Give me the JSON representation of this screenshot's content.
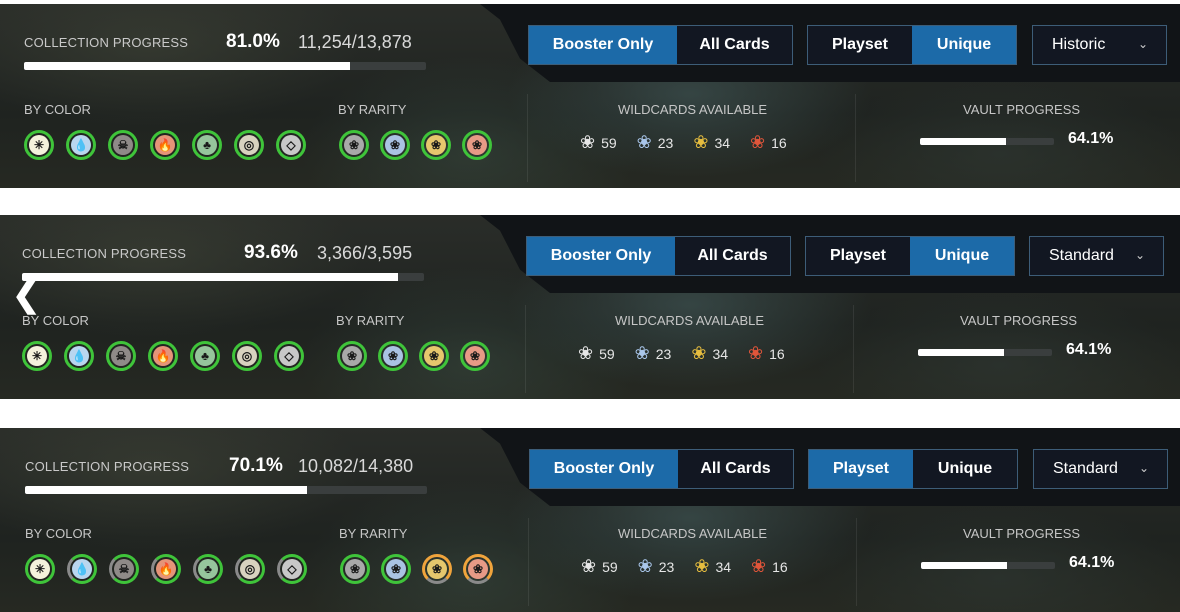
{
  "labels": {
    "collection_progress": "COLLECTION PROGRESS",
    "by_color": "BY COLOR",
    "by_rarity": "BY RARITY",
    "wildcards_available": "WILDCARDS AVAILABLE",
    "vault_progress": "VAULT PROGRESS"
  },
  "buttons": {
    "booster_only": "Booster Only",
    "all_cards": "All Cards",
    "playset": "Playset",
    "unique": "Unique"
  },
  "panels": [
    {
      "percent": "81.0%",
      "count": "11,254/13,878",
      "progress_fraction": 0.81,
      "filter_active": "booster_only",
      "mode_active": "unique",
      "format": "Historic",
      "vault_percent": "64.1%",
      "vault_fraction": 0.641
    },
    {
      "percent": "93.6%",
      "count": "3,366/3,595",
      "progress_fraction": 0.936,
      "filter_active": "booster_only",
      "mode_active": "unique",
      "format": "Standard",
      "vault_percent": "64.1%",
      "vault_fraction": 0.641
    },
    {
      "percent": "70.1%",
      "count": "10,082/14,380",
      "progress_fraction": 0.701,
      "filter_active": "booster_only",
      "mode_active": "playset",
      "format": "Standard",
      "vault_percent": "64.1%",
      "vault_fraction": 0.641
    }
  ],
  "colors": [
    {
      "name": "white-mana-icon",
      "glyph": "✳",
      "fill": "#f4f2dc"
    },
    {
      "name": "blue-mana-icon",
      "glyph": "💧",
      "fill": "#b9d6ef"
    },
    {
      "name": "black-mana-icon",
      "glyph": "☠",
      "fill": "#8f8a88"
    },
    {
      "name": "red-mana-icon",
      "glyph": "🔥",
      "fill": "#e59478"
    },
    {
      "name": "green-mana-icon",
      "glyph": "♣",
      "fill": "#96c59c"
    },
    {
      "name": "colorless-mana-icon",
      "glyph": "◎",
      "fill": "#d8d2bf"
    },
    {
      "name": "multicolor-mana-icon",
      "glyph": "◇",
      "fill": "#c8c8c8"
    }
  ],
  "rarities": [
    {
      "name": "common-rarity-icon",
      "fill": "#a9a9a9"
    },
    {
      "name": "uncommon-rarity-icon",
      "fill": "#aac3e3"
    },
    {
      "name": "rare-rarity-icon",
      "fill": "#e6c76d"
    },
    {
      "name": "mythic-rarity-icon",
      "fill": "#e79a86"
    }
  ],
  "wildcards": [
    {
      "name": "common-wildcard-icon",
      "count": "59",
      "color": "#e6e6e6"
    },
    {
      "name": "uncommon-wildcard-icon",
      "count": "23",
      "color": "#a9c6ea"
    },
    {
      "name": "rare-wildcard-icon",
      "count": "34",
      "color": "#e6bd3f"
    },
    {
      "name": "mythic-wildcard-icon",
      "count": "16",
      "color": "#e0553a"
    }
  ],
  "accent": "#1c6aa8",
  "ring_green": "#3fc43a"
}
